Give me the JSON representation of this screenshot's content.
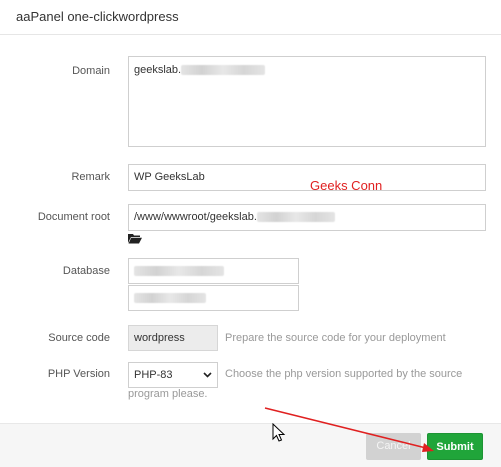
{
  "dialog": {
    "title": "aaPanel one-clickwordpress"
  },
  "form": {
    "domain": {
      "label": "Domain",
      "value": "geekslab."
    },
    "remark": {
      "label": "Remark",
      "value": "WP GeeksLab"
    },
    "docroot": {
      "label": "Document root",
      "value": "/www/wwwroot/geekslab."
    },
    "database": {
      "label": "Database"
    },
    "source": {
      "label": "Source code",
      "value": "wordpress",
      "hint": "Prepare the source code for your deployment"
    },
    "php": {
      "label": "PHP Version",
      "selected": "PHP-83",
      "hint_line1": "Choose the php version supported by the source",
      "hint_line2": "program please."
    }
  },
  "annotation": {
    "text": "Geeks Conn",
    "color": "#e02020"
  },
  "footer": {
    "cancel_label": "Cancel",
    "submit_label": "Submit"
  },
  "colors": {
    "submit": "#20a53a",
    "arrow": "#e02020"
  },
  "icons": [
    "folder-icon",
    "chevron-down-icon",
    "cursor-icon"
  ]
}
